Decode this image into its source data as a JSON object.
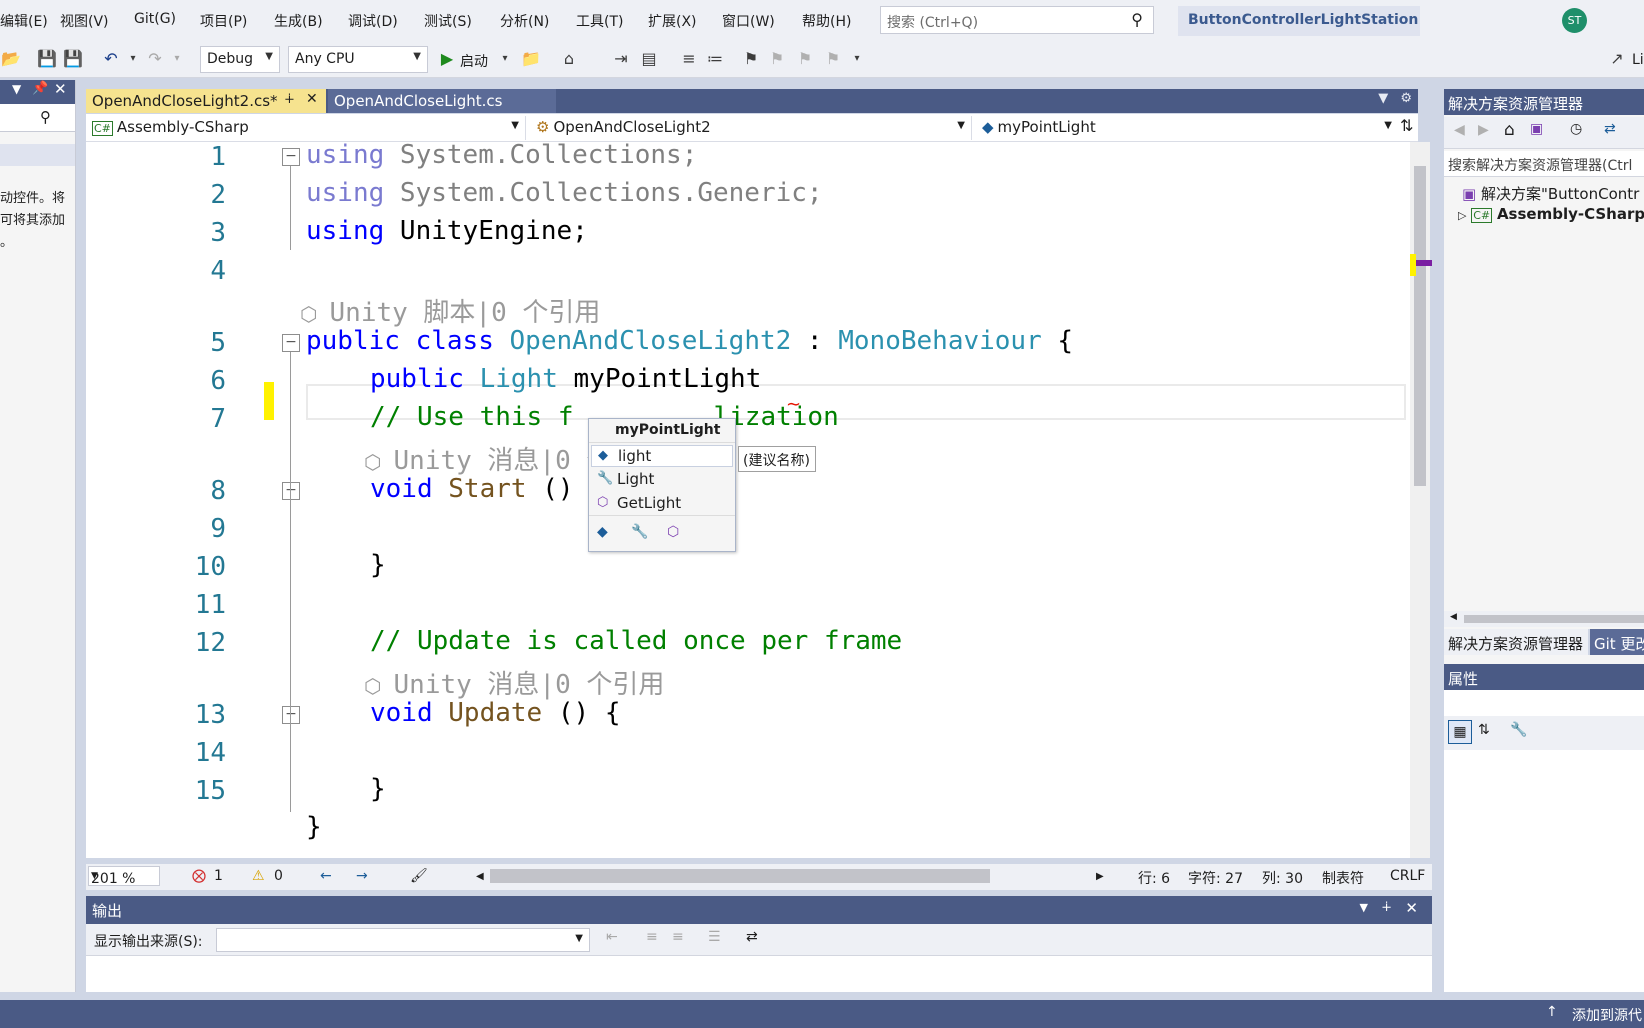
{
  "menu": {
    "items": [
      "编辑(E)",
      "视图(V)",
      "Git(G)",
      "项目(P)",
      "生成(B)",
      "调试(D)",
      "测试(S)",
      "分析(N)",
      "工具(T)",
      "扩展(X)",
      "窗口(W)",
      "帮助(H)"
    ],
    "search_placeholder": "搜索 (Ctrl+Q)",
    "solution_name": "ButtonControllerLightStation",
    "avatar_initials": "ST"
  },
  "toolbar": {
    "config": "Debug",
    "platform": "Any CPU",
    "start_label": "启动",
    "right_label": "Li"
  },
  "left_panel": {
    "text_lines": [
      "动控件。将",
      "可将其添加",
      "。"
    ]
  },
  "tabs": [
    {
      "label": "OpenAndCloseLight2.cs*",
      "active": true
    },
    {
      "label": "OpenAndCloseLight.cs",
      "active": false
    }
  ],
  "navbar": {
    "project": "Assembly-CSharp",
    "type": "OpenAndCloseLight2",
    "member": "myPointLight"
  },
  "code": {
    "line_numbers": [
      "1",
      "2",
      "3",
      "4",
      "5",
      "6",
      "7",
      "8",
      "9",
      "10",
      "11",
      "12",
      "13",
      "14",
      "15"
    ],
    "using_kw": "using",
    "line1_ns": " System.Collections;",
    "line2_ns": " System.Collections.Generic;",
    "line3_ns": " UnityEngine;",
    "codelens_class": "Unity 脚本|0 个引用",
    "codelens_method": "Unity 消息|0 个引用",
    "public_kw": "public",
    "class_kw": "class",
    "class_name": "OpenAndCloseLight2",
    "colon": " : ",
    "base_class": "MonoBehaviour",
    "open_brace": " {",
    "light_type": "Light",
    "field_name": "myPointLight",
    "comment_start": "// Use this f",
    "comment_start_tail": "lization",
    "void_kw": "void",
    "start_name": "Start",
    "parens": " ()",
    "parens_brace": " () {",
    "close_brace": "}",
    "comment_update": "// Update is called once per frame",
    "update_name": "Update"
  },
  "completion": {
    "header": "myPointLight",
    "items": [
      {
        "label": "light",
        "icon": "field-icon"
      },
      {
        "label": "Light",
        "icon": "wrench-icon"
      },
      {
        "label": "GetLight",
        "icon": "cube-icon"
      }
    ],
    "hint": "(建议名称)"
  },
  "edit_status": {
    "zoom": "201 %",
    "errors": "1",
    "warnings": "0",
    "line": "行: 6",
    "char": "字符: 27",
    "col": "列: 30",
    "tab": "制表符",
    "eol": "CRLF"
  },
  "output": {
    "title": "输出",
    "source_label": "显示输出来源(S):"
  },
  "right_panel": {
    "title": "解决方案资源管理器",
    "search_placeholder": "搜索解决方案资源管理器(Ctrl",
    "solution_item": "解决方案\"ButtonContr",
    "project_item": "Assembly-CSharp",
    "tab_solution": "解决方案资源管理器",
    "tab_git": "Git 更改",
    "properties_title": "属性"
  },
  "statusbar": {
    "right_text": "添加到源代"
  },
  "colors": {
    "accent": "#4a5a85",
    "active_tab": "#f6e38f",
    "keyword": "#0000ff",
    "type": "#2b91af",
    "comment": "#008000",
    "line_number": "#237893"
  }
}
